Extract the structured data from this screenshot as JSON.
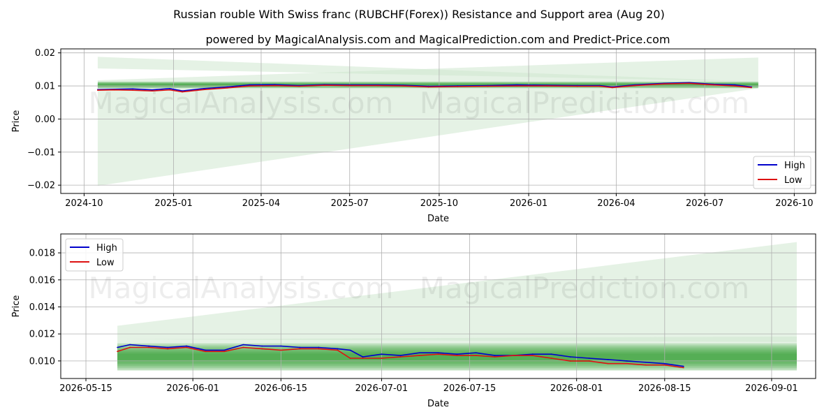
{
  "title": "Russian rouble With Swiss franc (RUBCHF(Forex)) Resistance and Support area (Aug 20)",
  "subtitle": "powered by MagicalAnalysis.com and MagicalPrediction.com and Predict-Price.com",
  "watermark_left": "MagicalAnalysis.com",
  "watermark_right": "MagicalPrediction.com",
  "colors": {
    "high": "#0000cc",
    "low": "#dd1111",
    "band": "#2e9a2e",
    "fan": "#cfe8cf",
    "grid": "#b0b0b0"
  },
  "chart_data": [
    {
      "type": "line",
      "xlabel": "Date",
      "ylabel": "Price",
      "x_ticks": [
        "2024-10",
        "2025-01",
        "2025-04",
        "2025-07",
        "2025-10",
        "2026-01",
        "2026-04",
        "2026-07",
        "2026-10"
      ],
      "x_tick_dates": [
        "2024-10-01",
        "2025-01-01",
        "2025-04-01",
        "2025-07-01",
        "2025-10-01",
        "2026-01-01",
        "2026-04-01",
        "2026-07-01",
        "2026-10-01"
      ],
      "xlim": [
        "2024-09-07",
        "2026-10-23"
      ],
      "y_ticks": [
        "−0.02",
        "−0.01",
        "0.00",
        "0.01",
        "0.02"
      ],
      "y_tick_values": [
        -0.02,
        -0.01,
        0.0,
        0.01,
        0.02
      ],
      "ylim": [
        -0.0225,
        0.0212
      ],
      "grid": true,
      "legend": "bottom-right",
      "legend_entries": [
        "High",
        "Low"
      ],
      "band": {
        "x": [
          "2024-10-15",
          "2026-08-25"
        ],
        "upper": 0.0113,
        "lower": 0.0093
      },
      "fans": [
        {
          "x": [
            "2024-10-15",
            "2026-08-25"
          ],
          "upper": [
            0.0188,
            0.0113
          ],
          "lower": [
            0.0153,
            0.0113
          ]
        },
        {
          "x": [
            "2024-10-15",
            "2026-08-25"
          ],
          "upper": [
            0.0117,
            0.0186
          ],
          "lower": [
            -0.0202,
            0.0093
          ]
        }
      ],
      "series": [
        {
          "name": "High",
          "x": [
            "2024-10-15",
            "2024-11-01",
            "2024-11-20",
            "2024-12-10",
            "2024-12-28",
            "2025-01-10",
            "2025-02-01",
            "2025-02-25",
            "2025-03-20",
            "2025-04-15",
            "2025-05-10",
            "2025-06-05",
            "2025-07-01",
            "2025-07-30",
            "2025-08-25",
            "2025-09-20",
            "2025-10-20",
            "2025-11-20",
            "2025-12-20",
            "2026-01-20",
            "2026-02-20",
            "2026-03-15",
            "2026-03-28",
            "2026-04-20",
            "2026-05-20",
            "2026-06-15",
            "2026-07-10",
            "2026-08-01",
            "2026-08-18"
          ],
          "values": [
            0.0089,
            0.009,
            0.0091,
            0.0088,
            0.0092,
            0.0085,
            0.0092,
            0.0097,
            0.0103,
            0.0104,
            0.0101,
            0.0104,
            0.0103,
            0.0103,
            0.0102,
            0.0099,
            0.01,
            0.0101,
            0.0103,
            0.0102,
            0.0101,
            0.0101,
            0.0097,
            0.0103,
            0.0108,
            0.011,
            0.0105,
            0.0103,
            0.0097
          ]
        },
        {
          "name": "Low",
          "x": [
            "2024-10-15",
            "2024-11-01",
            "2024-11-20",
            "2024-12-10",
            "2024-12-28",
            "2025-01-10",
            "2025-02-01",
            "2025-02-25",
            "2025-03-20",
            "2025-04-15",
            "2025-05-10",
            "2025-06-05",
            "2025-07-01",
            "2025-07-30",
            "2025-08-25",
            "2025-09-20",
            "2025-10-20",
            "2025-11-20",
            "2025-12-20",
            "2026-01-20",
            "2026-02-20",
            "2026-03-15",
            "2026-03-28",
            "2026-04-20",
            "2026-05-20",
            "2026-06-15",
            "2026-07-10",
            "2026-08-01",
            "2026-08-18"
          ],
          "values": [
            0.0087,
            0.0088,
            0.0087,
            0.0085,
            0.0088,
            0.0082,
            0.0089,
            0.0094,
            0.01,
            0.0101,
            0.0099,
            0.0102,
            0.0101,
            0.0101,
            0.01,
            0.0097,
            0.0098,
            0.0099,
            0.01,
            0.01,
            0.0099,
            0.0099,
            0.0095,
            0.0101,
            0.0106,
            0.0108,
            0.0103,
            0.01,
            0.0095
          ]
        }
      ]
    },
    {
      "type": "line",
      "xlabel": "Date",
      "ylabel": "Price",
      "x_ticks": [
        "2026-05-15",
        "2026-06-01",
        "2026-06-15",
        "2026-07-01",
        "2026-07-15",
        "2026-08-01",
        "2026-08-15",
        "2026-09-01"
      ],
      "x_tick_dates": [
        "2026-05-15",
        "2026-06-01",
        "2026-06-15",
        "2026-07-01",
        "2026-07-15",
        "2026-08-01",
        "2026-08-15",
        "2026-09-01"
      ],
      "xlim": [
        "2026-05-11",
        "2026-09-08"
      ],
      "y_ticks": [
        "0.010",
        "0.012",
        "0.014",
        "0.016",
        "0.018"
      ],
      "y_tick_values": [
        0.01,
        0.012,
        0.014,
        0.016,
        0.018
      ],
      "ylim": [
        0.0087,
        0.0194
      ],
      "grid": true,
      "legend": "top-left",
      "legend_entries": [
        "High",
        "Low"
      ],
      "band": {
        "x": [
          "2026-05-20",
          "2026-09-05"
        ],
        "upper": 0.0113,
        "lower": 0.0093
      },
      "fans": [
        {
          "x": [
            "2026-05-20",
            "2026-09-05"
          ],
          "upper": [
            0.0126,
            0.0188
          ],
          "lower": [
            0.0093,
            0.0093
          ]
        },
        {
          "x": [
            "2026-05-20",
            "2026-09-05"
          ],
          "upper": [
            0.0116,
            0.0118
          ],
          "lower": [
            0.0116,
            0.0114
          ]
        }
      ],
      "series": [
        {
          "name": "High",
          "x": [
            "2026-05-20",
            "2026-05-22",
            "2026-05-25",
            "2026-05-28",
            "2026-05-31",
            "2026-06-03",
            "2026-06-06",
            "2026-06-09",
            "2026-06-12",
            "2026-06-15",
            "2026-06-18",
            "2026-06-21",
            "2026-06-24",
            "2026-06-26",
            "2026-06-28",
            "2026-07-01",
            "2026-07-04",
            "2026-07-07",
            "2026-07-10",
            "2026-07-13",
            "2026-07-16",
            "2026-07-19",
            "2026-07-22",
            "2026-07-25",
            "2026-07-28",
            "2026-07-31",
            "2026-08-03",
            "2026-08-06",
            "2026-08-09",
            "2026-08-12",
            "2026-08-15",
            "2026-08-18"
          ],
          "values": [
            0.011,
            0.0112,
            0.0111,
            0.011,
            0.0111,
            0.0108,
            0.0108,
            0.0112,
            0.0111,
            0.0111,
            0.011,
            0.011,
            0.0109,
            0.0108,
            0.0103,
            0.0105,
            0.0104,
            0.0106,
            0.0106,
            0.0105,
            0.0106,
            0.0104,
            0.0104,
            0.0105,
            0.0105,
            0.0103,
            0.0102,
            0.0101,
            0.01,
            0.0099,
            0.0098,
            0.0096
          ]
        },
        {
          "name": "Low",
          "x": [
            "2026-05-20",
            "2026-05-22",
            "2026-05-25",
            "2026-05-28",
            "2026-05-31",
            "2026-06-03",
            "2026-06-06",
            "2026-06-09",
            "2026-06-12",
            "2026-06-15",
            "2026-06-18",
            "2026-06-21",
            "2026-06-24",
            "2026-06-26",
            "2026-06-28",
            "2026-07-01",
            "2026-07-04",
            "2026-07-07",
            "2026-07-10",
            "2026-07-13",
            "2026-07-16",
            "2026-07-19",
            "2026-07-22",
            "2026-07-25",
            "2026-07-28",
            "2026-07-31",
            "2026-08-03",
            "2026-08-06",
            "2026-08-09",
            "2026-08-12",
            "2026-08-15",
            "2026-08-18"
          ],
          "values": [
            0.0107,
            0.011,
            0.011,
            0.0109,
            0.011,
            0.0107,
            0.0107,
            0.011,
            0.0109,
            0.0108,
            0.0109,
            0.0109,
            0.0108,
            0.0102,
            0.0102,
            0.0102,
            0.0103,
            0.0104,
            0.0105,
            0.0104,
            0.0104,
            0.0103,
            0.0104,
            0.0104,
            0.0102,
            0.01,
            0.01,
            0.0098,
            0.0098,
            0.0097,
            0.0097,
            0.0095
          ]
        }
      ]
    }
  ]
}
